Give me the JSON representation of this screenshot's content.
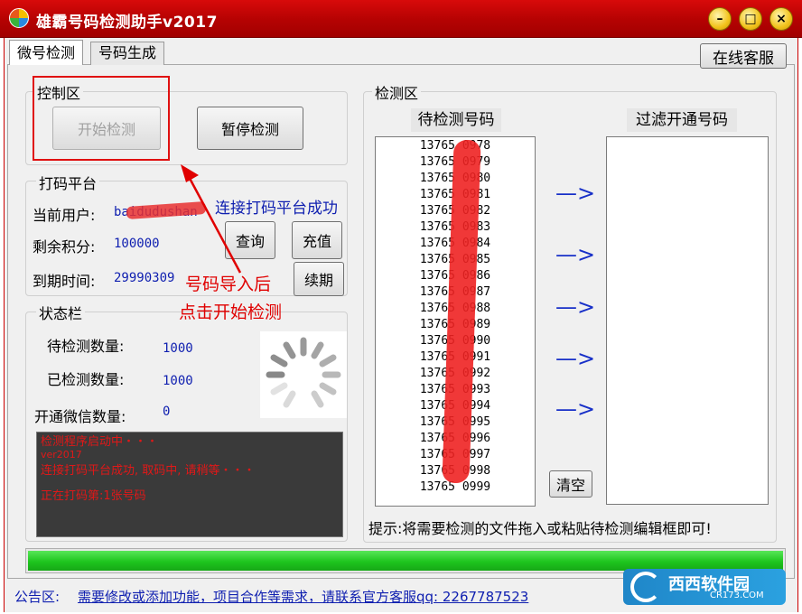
{
  "window": {
    "title": "雄霸号码检测助手v2017",
    "minimize": "–",
    "maximize": "□",
    "close": "×"
  },
  "tabs": [
    {
      "label": "微号检测"
    },
    {
      "label": "号码生成"
    }
  ],
  "online_service_button": "在线客服",
  "control": {
    "title": "控制区",
    "start_button": "开始检测",
    "pause_button": "暂停检测"
  },
  "platform": {
    "title": "打码平台",
    "user_label": "当前用户:",
    "user_value": "baidudushan",
    "points_label": "剩余积分:",
    "points_value": "100000",
    "expire_label": "到期时间:",
    "expire_value": "29990309",
    "query_button": "查询",
    "recharge_button": "充值",
    "renew_button": "续期"
  },
  "status": {
    "title": "状态栏",
    "pending_label": "待检测数量:",
    "pending_value": "1000",
    "checked_label": "已检测数量:",
    "checked_value": "1000",
    "opened_label": "开通微信数量:",
    "opened_value": "0",
    "log": [
      "检测程序启动中・・・",
      "ver2017",
      "连接打码平台成功, 取码中, 请稍等・・・",
      "正在打码第:1张号码"
    ]
  },
  "annotations": {
    "connect_success": "连接打码平台成功",
    "hint_line1": "号码导入后",
    "hint_line2": "点击开始检测"
  },
  "detect": {
    "title": "检测区",
    "pending_header": "待检测号码",
    "filter_header": "过滤开通号码",
    "numbers": [
      "13765  0978",
      "13765  0979",
      "13765  0980",
      "13765  0981",
      "13765  0982",
      "13765  0983",
      "13765  0984",
      "13765  0985",
      "13765  0986",
      "13765  0987",
      "13765  0988",
      "13765  0989",
      "13765  0990",
      "13765  0991",
      "13765  0992",
      "13765  0993",
      "13765  0994",
      "13765  0995",
      "13765  0996",
      "13765  0997",
      "13765  0998",
      "13765  0999"
    ],
    "arrow": "—>",
    "clear_button": "清空",
    "tip": "提示:将需要检测的文件拖入或粘贴待检测编辑框即可!"
  },
  "progress": {
    "fraction": 1.0,
    "color": "#1ec51e"
  },
  "notice": {
    "label": "公告区:",
    "text": "需要修改或添加功能，项目合作等需求，请联系官方客服qq: 2267787523"
  },
  "watermark": {
    "brand": "西西软件园",
    "url": "CR173.COM"
  },
  "colors": {
    "title_bar": "#c00000",
    "annotation": "#e00000",
    "link": "#1020b0"
  }
}
